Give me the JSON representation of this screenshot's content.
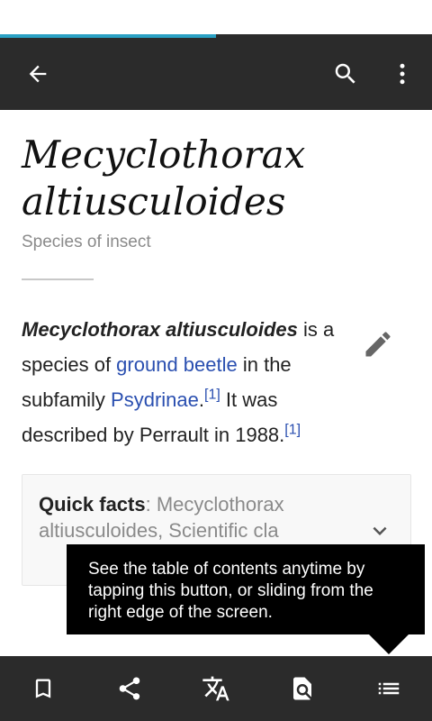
{
  "progress": 0.5,
  "toolbar": {
    "back_icon": "arrow-left-icon",
    "search_icon": "search-icon",
    "overflow_icon": "more-vertical-icon"
  },
  "article": {
    "title_line1": "Mecyclothorax",
    "title_line2": "altiusculoides",
    "description": "Species of insect",
    "edit_icon": "pencil-icon",
    "paragraph": {
      "lead": "Mecyclothorax altiusculoides",
      "text1": " is a species of ",
      "link1": "ground beetle",
      "text2": " in the subfamily ",
      "link2": "Psydrinae",
      "text3": ".",
      "ref1": "[1]",
      "text4": " It was described by Perrault in 1988.",
      "ref2": "[1]"
    }
  },
  "quick_facts": {
    "label": "Quick facts",
    "text": ": Mecyclothorax altiusculoides, Scientific cla"
  },
  "tooltip": {
    "text": "See the table of contents anytime by tapping this button, or sliding from the right edge of the screen."
  },
  "bottom_bar": {
    "icons": [
      "bookmark-icon",
      "share-icon",
      "translate-icon",
      "find-in-page-icon",
      "table-of-contents-icon"
    ]
  }
}
